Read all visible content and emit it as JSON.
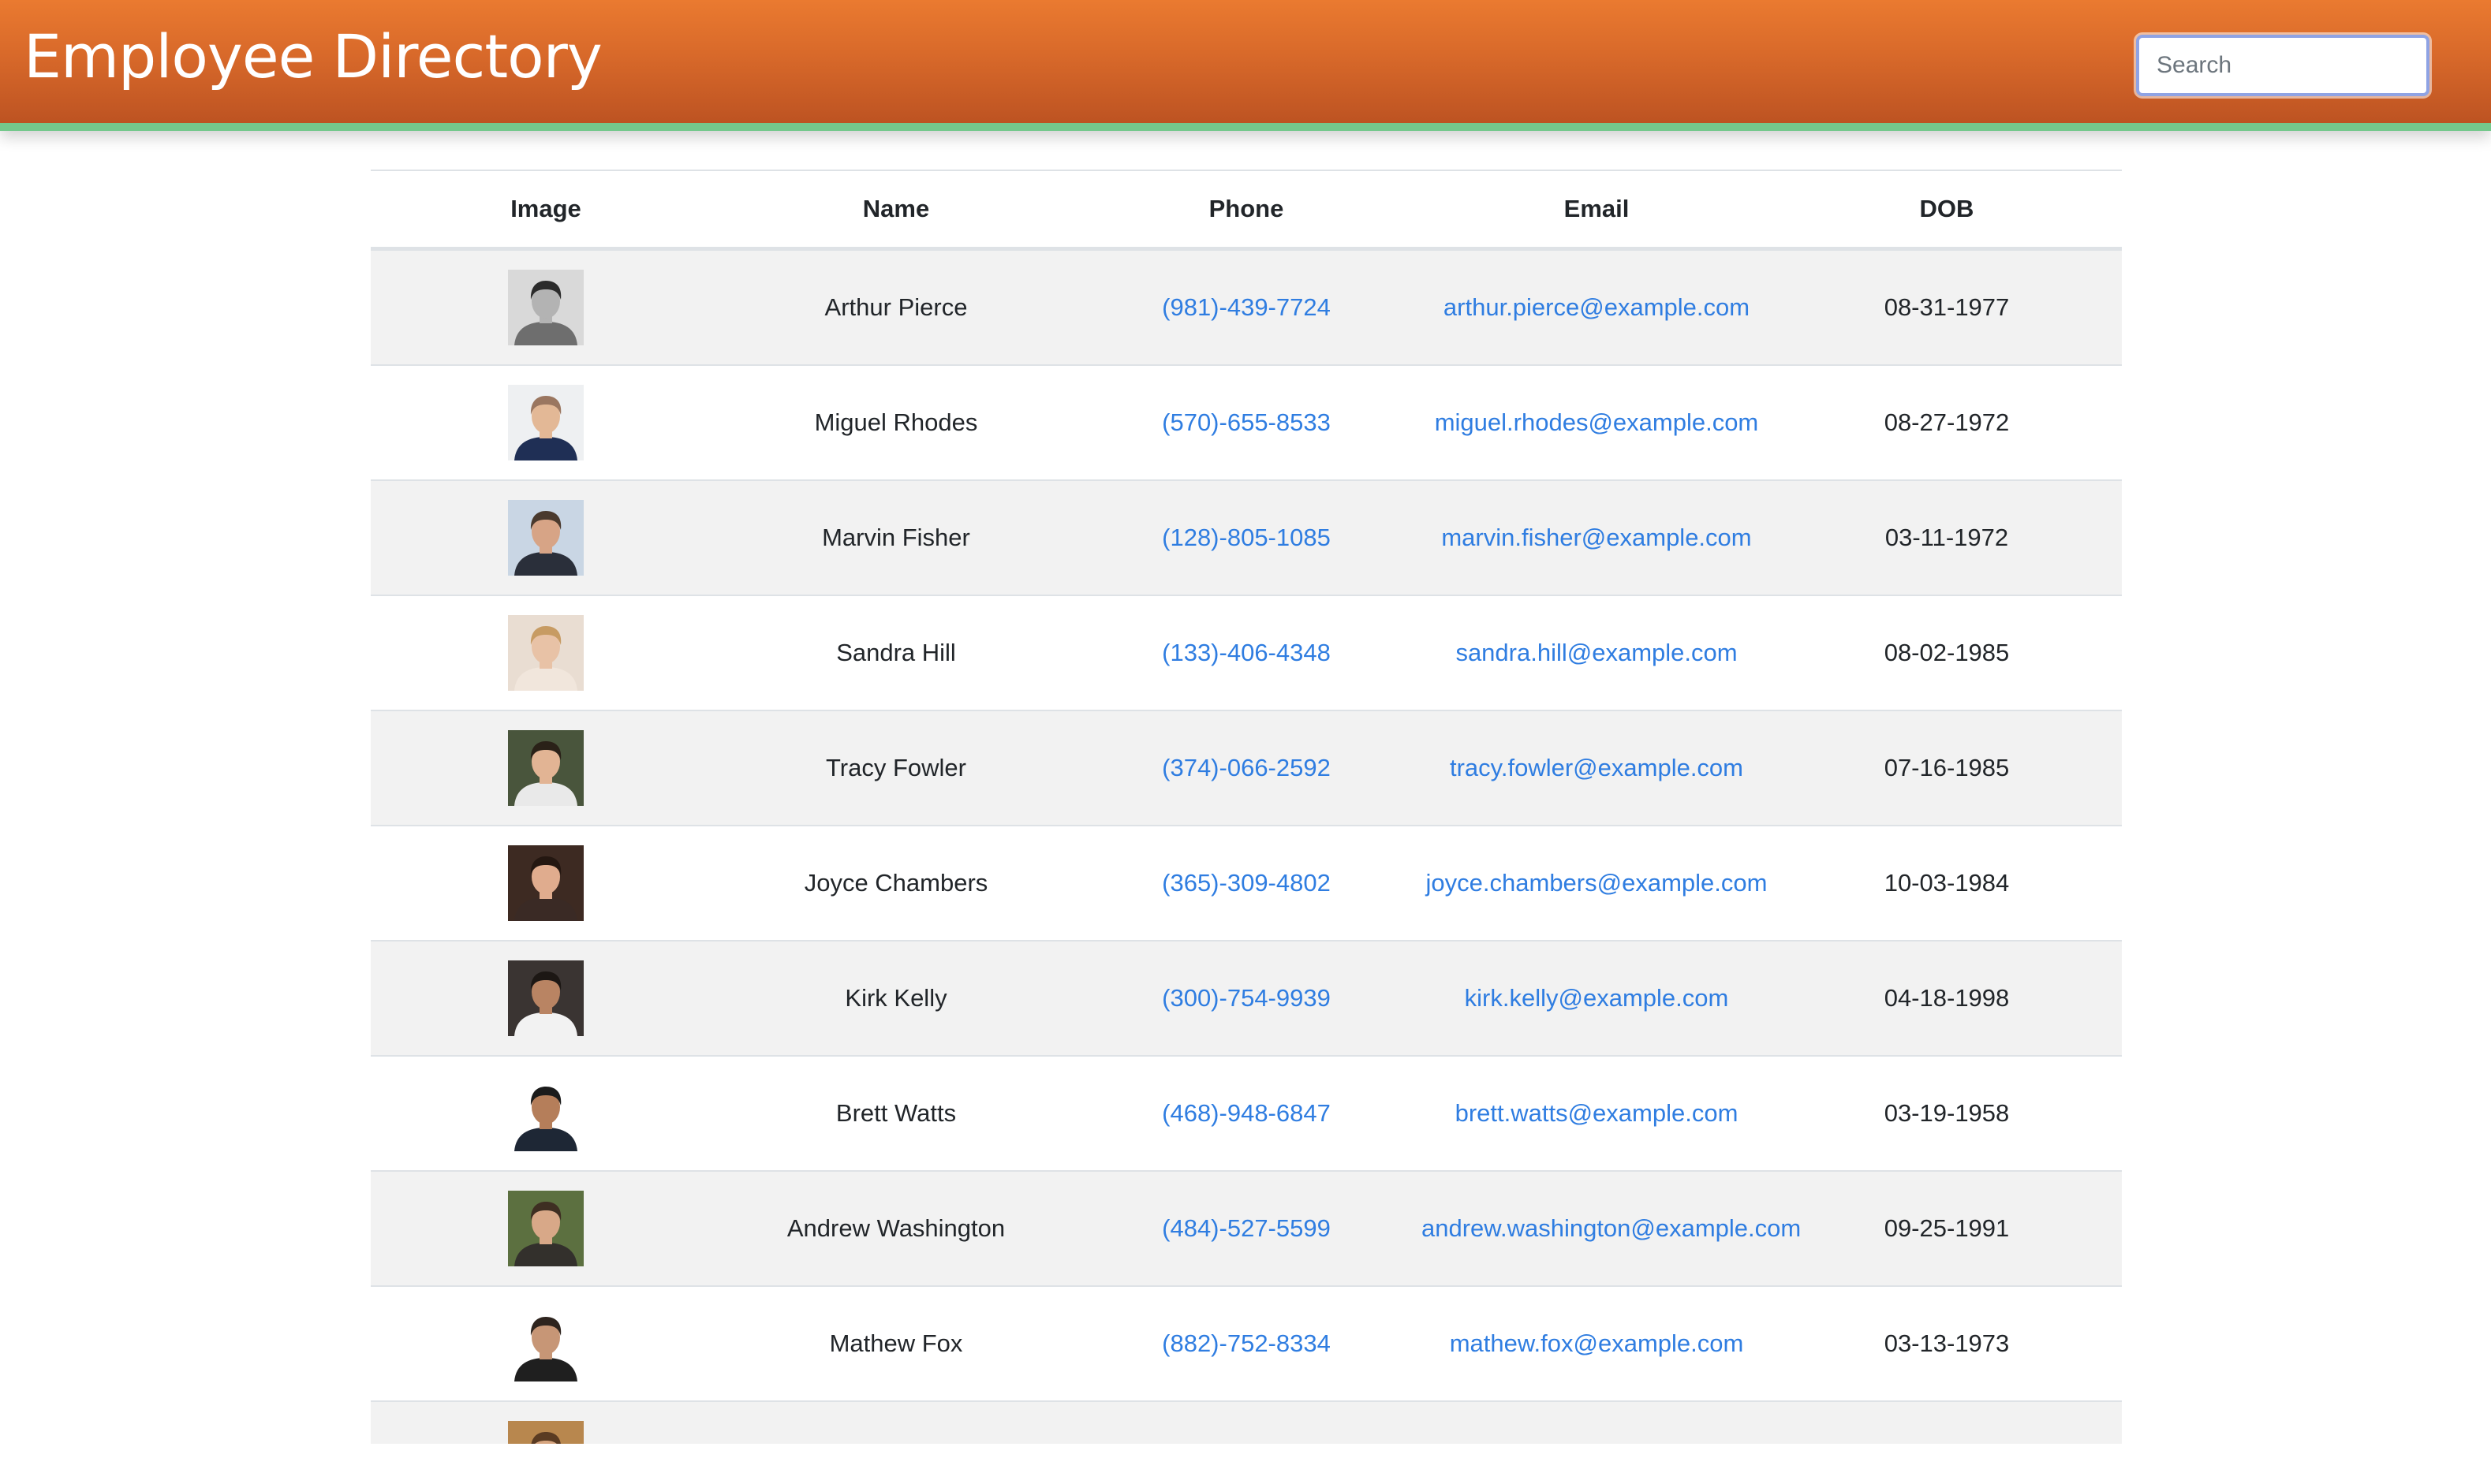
{
  "header": {
    "title": "Employee Directory",
    "search_placeholder": "Search"
  },
  "table": {
    "columns": [
      "Image",
      "Name",
      "Phone",
      "Email",
      "DOB"
    ],
    "rows": [
      {
        "name": "Arthur Pierce",
        "phone": "(981)-439-7724",
        "email": "arthur.pierce@example.com",
        "dob": "08-31-1977",
        "avatar": {
          "bg": "#d9d9d9",
          "skin": "#b3b3b3",
          "hair": "#2b2b2b",
          "shirt": "#6e6e6e"
        }
      },
      {
        "name": "Miguel Rhodes",
        "phone": "(570)-655-8533",
        "email": "miguel.rhodes@example.com",
        "dob": "08-27-1972",
        "avatar": {
          "bg": "#eef0f2",
          "skin": "#e3b896",
          "hair": "#9a7660",
          "shirt": "#1f2f55"
        }
      },
      {
        "name": "Marvin Fisher",
        "phone": "(128)-805-1085",
        "email": "marvin.fisher@example.com",
        "dob": "03-11-1972",
        "avatar": {
          "bg": "#c9d6e4",
          "skin": "#d7a486",
          "hair": "#4a3a2e",
          "shirt": "#2a2f3a"
        }
      },
      {
        "name": "Sandra Hill",
        "phone": "(133)-406-4348",
        "email": "sandra.hill@example.com",
        "dob": "08-02-1985",
        "avatar": {
          "bg": "#e9ddd2",
          "skin": "#e8c2a6",
          "hair": "#c79b63",
          "shirt": "#f1e6dc"
        }
      },
      {
        "name": "Tracy Fowler",
        "phone": "(374)-066-2592",
        "email": "tracy.fowler@example.com",
        "dob": "07-16-1985",
        "avatar": {
          "bg": "#49553c",
          "skin": "#e2b494",
          "hair": "#2a2118",
          "shirt": "#e9e9e9"
        }
      },
      {
        "name": "Joyce Chambers",
        "phone": "(365)-309-4802",
        "email": "joyce.chambers@example.com",
        "dob": "10-03-1984",
        "avatar": {
          "bg": "#3d2a22",
          "skin": "#e0ac8e",
          "hair": "#241711",
          "shirt": "#3a2a25"
        }
      },
      {
        "name": "Kirk Kelly",
        "phone": "(300)-754-9939",
        "email": "kirk.kelly@example.com",
        "dob": "04-18-1998",
        "avatar": {
          "bg": "#3a3432",
          "skin": "#b98463",
          "hair": "#1c1714",
          "shirt": "#f2f2f2"
        }
      },
      {
        "name": "Brett Watts",
        "phone": "(468)-948-6847",
        "email": "brett.watts@example.com",
        "dob": "03-19-1958",
        "avatar": {
          "bg": "#ffffff",
          "skin": "#b57e5a",
          "hair": "#1b1b1b",
          "shirt": "#1e2735"
        }
      },
      {
        "name": "Andrew Washington",
        "phone": "(484)-527-5599",
        "email": "andrew.washington@example.com",
        "dob": "09-25-1991",
        "avatar": {
          "bg": "#5c7040",
          "skin": "#d8a888",
          "hair": "#3e2e22",
          "shirt": "#33302c"
        }
      },
      {
        "name": "Mathew Fox",
        "phone": "(882)-752-8334",
        "email": "mathew.fox@example.com",
        "dob": "03-13-1973",
        "avatar": {
          "bg": "#ffffff",
          "skin": "#c79676",
          "hair": "#2e241e",
          "shirt": "#1f1f1f"
        }
      },
      {
        "name": "",
        "phone": "",
        "email": "",
        "dob": "",
        "avatar": {
          "bg": "#b8874e",
          "skin": "#d6a57f",
          "hair": "#5a3b22",
          "shirt": "#6a4a2d"
        }
      }
    ]
  }
}
